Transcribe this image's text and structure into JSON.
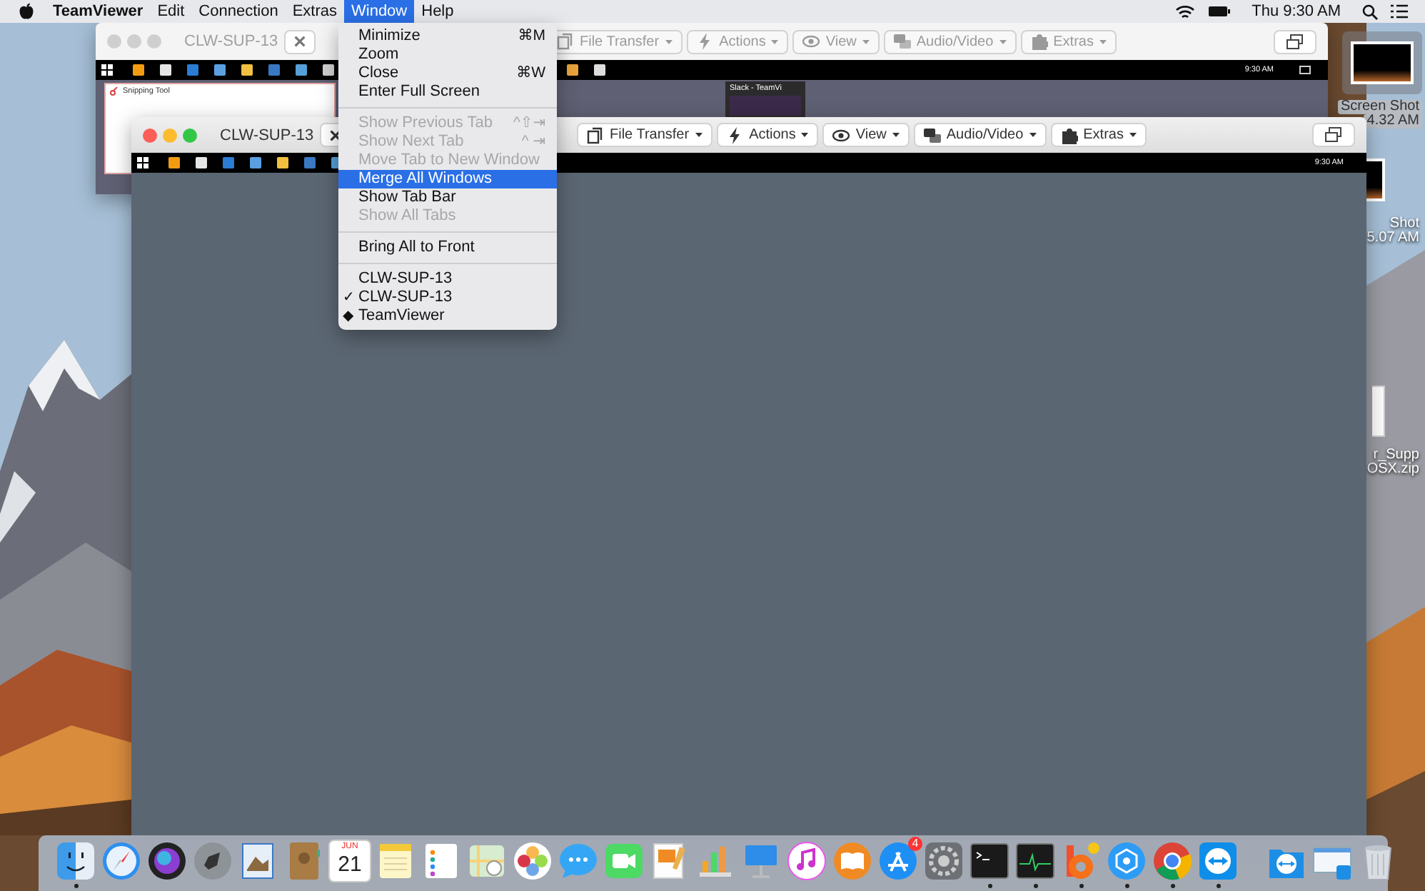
{
  "menu_bar": {
    "items": [
      {
        "label": "TeamViewer",
        "selected": false
      },
      {
        "label": "Edit",
        "selected": false
      },
      {
        "label": "Connection",
        "selected": false
      },
      {
        "label": "Extras",
        "selected": false
      },
      {
        "label": "Window",
        "selected": true
      },
      {
        "label": "Help",
        "selected": false
      }
    ],
    "clock": "Thu 9:30 AM"
  },
  "back_window": {
    "title": "CLW-SUP-13",
    "active": false,
    "toolbar": [
      {
        "label": "File Transfer",
        "kind": "files"
      },
      {
        "label": "Actions",
        "kind": "bolt"
      },
      {
        "label": "View",
        "kind": "eye"
      },
      {
        "label": "Audio/Video",
        "kind": "chat"
      },
      {
        "label": "Extras",
        "kind": "puzzle"
      }
    ],
    "taskbar": {
      "clock": "9:30 AM",
      "tray": true
    },
    "remote_windows": [
      {
        "kind": "snipping",
        "title": "Snipping Tool"
      },
      {
        "kind": "thumbnail",
        "title": "Slack - TeamVi"
      }
    ]
  },
  "front_window": {
    "title": "CLW-SUP-13",
    "active": true,
    "toolbar": [
      {
        "label": "File Transfer",
        "kind": "files"
      },
      {
        "label": "Actions",
        "kind": "bolt"
      },
      {
        "label": "View",
        "kind": "eye"
      },
      {
        "label": "Audio/Video",
        "kind": "chat"
      },
      {
        "label": "Extras",
        "kind": "puzzle"
      }
    ],
    "taskbar": {
      "clock": "9:30 AM",
      "tray": false
    }
  },
  "window_menu": {
    "sections": [
      {
        "items": [
          {
            "label": "Minimize",
            "shortcut": "⌘M",
            "disabled": false,
            "selected": false
          },
          {
            "label": "Zoom",
            "disabled": false,
            "selected": false
          },
          {
            "label": "Close",
            "shortcut": "⌘W",
            "disabled": false,
            "selected": false
          },
          {
            "label": "Enter Full Screen",
            "disabled": false,
            "selected": false
          }
        ]
      },
      {
        "items": [
          {
            "label": "Show Previous Tab",
            "shortcut": "^⇧⇥",
            "disabled": true,
            "selected": false
          },
          {
            "label": "Show Next Tab",
            "shortcut": "^ ⇥",
            "disabled": true,
            "selected": false
          },
          {
            "label": "Move Tab to New Window",
            "disabled": true,
            "selected": false
          },
          {
            "label": "Merge All Windows",
            "disabled": false,
            "selected": true
          },
          {
            "label": "Show Tab Bar",
            "disabled": false,
            "selected": false
          },
          {
            "label": "Show All Tabs",
            "disabled": true,
            "selected": false
          }
        ]
      },
      {
        "items": [
          {
            "label": "Bring All to Front",
            "disabled": false,
            "selected": false
          }
        ]
      },
      {
        "items": [
          {
            "label": "CLW-SUP-13",
            "disabled": false,
            "selected": false
          },
          {
            "label": "CLW-SUP-13",
            "mark": "✓",
            "disabled": false,
            "selected": false
          },
          {
            "label": "TeamViewer",
            "mark": "◆",
            "disabled": false,
            "selected": false
          }
        ]
      }
    ]
  },
  "desktop_items": [
    {
      "kind": "screenshot",
      "lines": [
        "Screen Shot",
        "4.32 AM"
      ],
      "selected": true
    },
    {
      "kind": "screenshot",
      "lines": [
        "Shot",
        "5.07 AM"
      ],
      "selected": false
    },
    {
      "kind": "zip",
      "lines": [
        "r_Supp",
        "OSX.zip"
      ],
      "selected": false
    }
  ],
  "dock": {
    "items": [
      {
        "kind": "finder",
        "running": true
      },
      {
        "kind": "safari",
        "running": false
      },
      {
        "kind": "siri",
        "running": false
      },
      {
        "kind": "launchpad",
        "running": false
      },
      {
        "kind": "preview",
        "running": false
      },
      {
        "kind": "contacts",
        "running": false
      },
      {
        "kind": "calendar",
        "month": "JUN",
        "day": "21",
        "running": false
      },
      {
        "kind": "notes",
        "running": false
      },
      {
        "kind": "reminders",
        "running": false
      },
      {
        "kind": "maps",
        "running": false
      },
      {
        "kind": "photos",
        "running": false
      },
      {
        "kind": "messages",
        "running": false
      },
      {
        "kind": "facetime",
        "running": false
      },
      {
        "kind": "pages",
        "running": false
      },
      {
        "kind": "numbers",
        "running": false
      },
      {
        "kind": "keynote",
        "running": false
      },
      {
        "kind": "music",
        "running": false
      },
      {
        "kind": "books",
        "running": false
      },
      {
        "kind": "appstore",
        "badge": "4",
        "running": false
      },
      {
        "kind": "settings",
        "running": false
      },
      {
        "kind": "terminal",
        "running": true
      },
      {
        "kind": "monitor",
        "running": true
      },
      {
        "kind": "bapp",
        "running": true
      },
      {
        "kind": "network",
        "running": true
      },
      {
        "kind": "chrome",
        "running": true
      },
      {
        "kind": "teamviewer",
        "running": true
      },
      {
        "kind": "separator"
      },
      {
        "kind": "tvfolder",
        "running": false
      },
      {
        "kind": "windowshot",
        "running": false
      },
      {
        "kind": "trash",
        "running": false
      }
    ]
  }
}
